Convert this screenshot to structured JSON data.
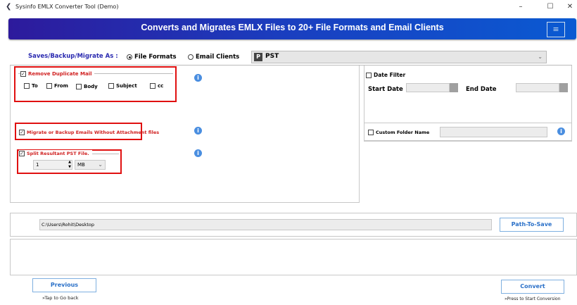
{
  "window": {
    "title": "Sysinfo EMLX Converter Tool (Demo)",
    "minimize": "–",
    "maximize": "☐",
    "close": "✕"
  },
  "banner": {
    "title": "Converts and Migrates EMLX Files to 20+ File Formats and Email Clients",
    "menu_icon": "≡"
  },
  "saveas": {
    "label": "Saves/Backup/Migrate As :",
    "options": [
      {
        "label": "File Formats",
        "selected": true
      },
      {
        "label": "Email Clients",
        "selected": false
      }
    ],
    "format": "PST",
    "format_icon": "P"
  },
  "left": {
    "dup": {
      "label": "Remove Duplicate Mail",
      "checked": true,
      "fields": [
        "To",
        "From",
        "Body",
        "Subject",
        "cc"
      ]
    },
    "noattach": {
      "label": "Migrate or Backup Emails Without Attachment files",
      "checked": true
    },
    "split": {
      "label": "Split Resultant PST File.",
      "checked": true,
      "value": "1",
      "unit": "MB"
    }
  },
  "right": {
    "date_filter": "Date Filter",
    "start_date": "Start Date",
    "end_date": "End Date",
    "custom_folder": "Custom Folder Name"
  },
  "path": {
    "value": "C:\\Users\\Rohit\\Desktop",
    "button": "Path-To-Save"
  },
  "footer": {
    "previous": "Previous",
    "previous_hint": "»Tap to Go back",
    "convert": "Convert",
    "convert_hint": "»Press to Start Conversion"
  },
  "colors": {
    "accent": "#2a70c8",
    "highlight": "#e01010"
  }
}
